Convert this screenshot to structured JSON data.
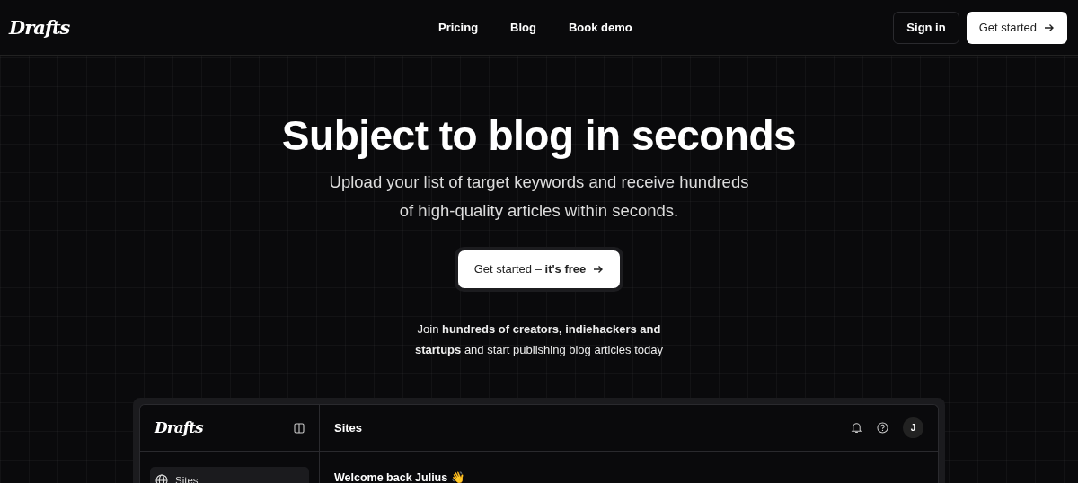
{
  "navbar": {
    "logo": "Drafts",
    "links": [
      "Pricing",
      "Blog",
      "Book demo"
    ],
    "sign_in": "Sign in",
    "get_started": "Get started"
  },
  "hero": {
    "title": "Subject to blog in seconds",
    "subtitle_lines": [
      "Upload your list of target keywords and receive hundreds",
      "of high-quality articles within seconds."
    ],
    "cta": "Get started – **it's free**",
    "social_proof_lines": [
      "Join **hundreds of creators, indiehackers and**",
      "**startups** and start publishing blog articles today"
    ]
  },
  "app_preview": {
    "logo": "Drafts",
    "header_title": "Sites",
    "avatar": "J",
    "sidebar_items": [
      {
        "label": "Sites",
        "selected": true
      }
    ],
    "welcome": "Welcome back Julius 👋"
  }
}
